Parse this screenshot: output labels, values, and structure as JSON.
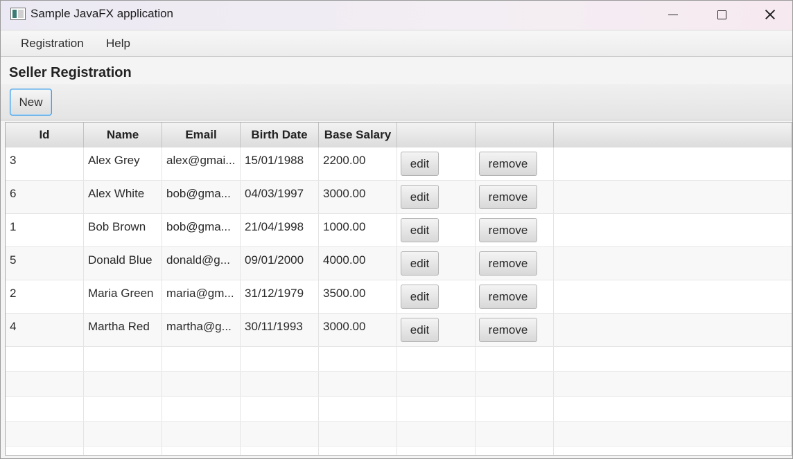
{
  "window": {
    "title": "Sample JavaFX application",
    "controls": [
      "minimize-icon",
      "maximize-icon",
      "close-icon"
    ]
  },
  "menubar": {
    "items": [
      {
        "label": "Registration"
      },
      {
        "label": "Help"
      }
    ]
  },
  "page": {
    "title": "Seller Registration",
    "new_button": "New"
  },
  "table": {
    "columns": [
      "Id",
      "Name",
      "Email",
      "Birth Date",
      "Base Salary",
      "",
      ""
    ],
    "rows": [
      {
        "id": "3",
        "name": "Alex Grey",
        "email": "alex@gmai...",
        "birth_date": "15/01/1988",
        "base_salary": "2200.00",
        "edit": "edit",
        "remove": "remove"
      },
      {
        "id": "6",
        "name": "Alex White",
        "email": "bob@gma...",
        "birth_date": "04/03/1997",
        "base_salary": "3000.00",
        "edit": "edit",
        "remove": "remove"
      },
      {
        "id": "1",
        "name": "Bob Brown",
        "email": "bob@gma...",
        "birth_date": "21/04/1998",
        "base_salary": "1000.00",
        "edit": "edit",
        "remove": "remove"
      },
      {
        "id": "5",
        "name": "Donald Blue",
        "email": "donald@g...",
        "birth_date": "09/01/2000",
        "base_salary": "4000.00",
        "edit": "edit",
        "remove": "remove"
      },
      {
        "id": "2",
        "name": "Maria Green",
        "email": "maria@gm...",
        "birth_date": "31/12/1979",
        "base_salary": "3500.00",
        "edit": "edit",
        "remove": "remove"
      },
      {
        "id": "4",
        "name": "Martha Red",
        "email": "martha@g...",
        "birth_date": "30/11/1993",
        "base_salary": "3000.00",
        "edit": "edit",
        "remove": "remove"
      }
    ]
  }
}
